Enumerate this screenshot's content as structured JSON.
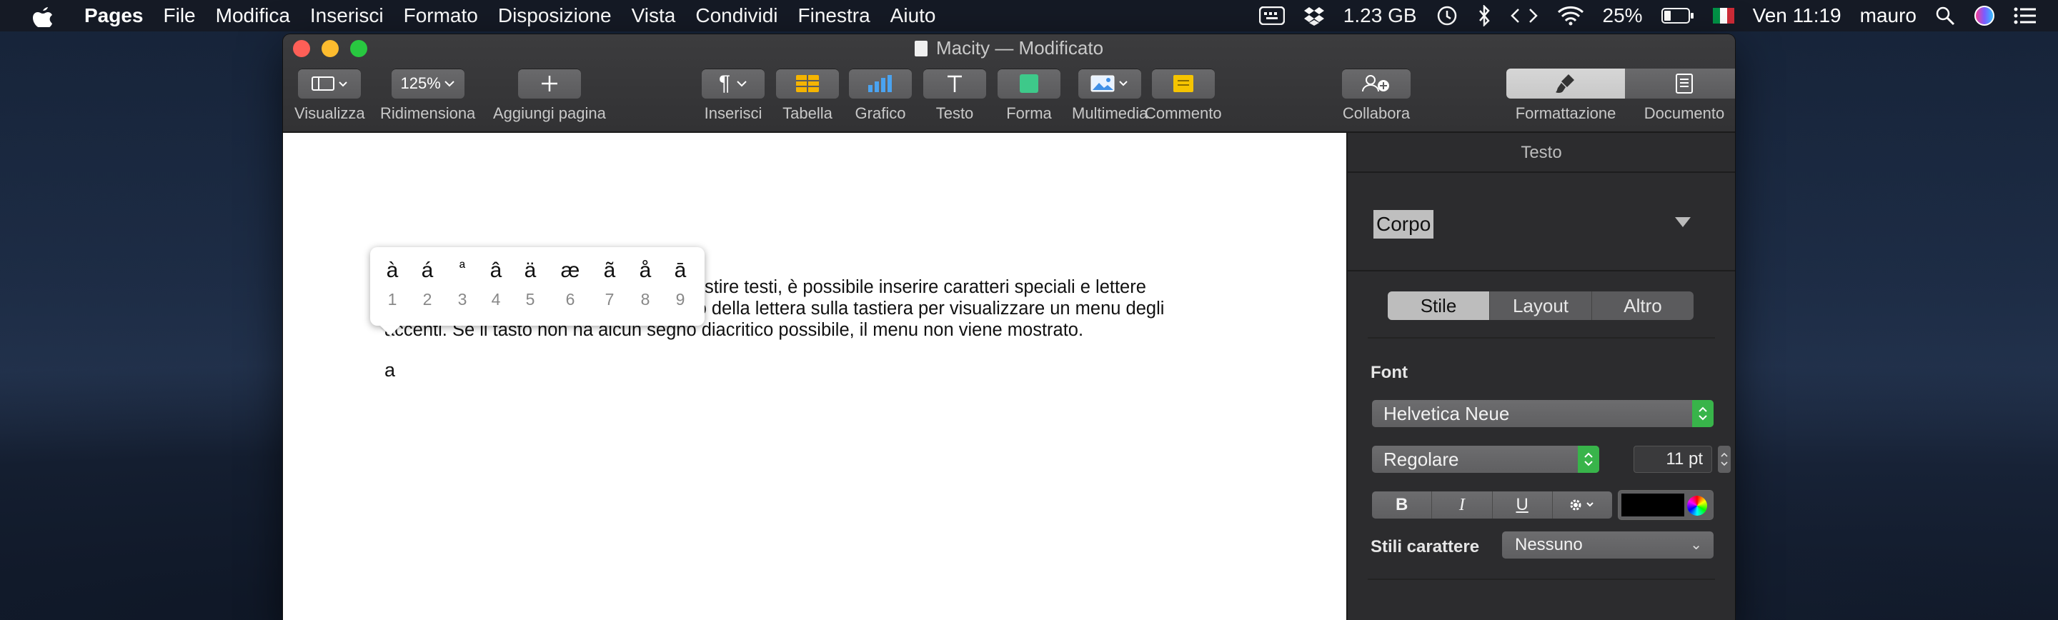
{
  "menubar": {
    "app_name": "Pages",
    "items": [
      "File",
      "Modifica",
      "Inserisci",
      "Formato",
      "Disposizione",
      "Vista",
      "Condividi",
      "Finestra",
      "Aiuto"
    ],
    "storage": "1.23 GB",
    "battery": "25%",
    "clock": "Ven 11:19",
    "user": "mauro"
  },
  "window": {
    "title": "Macity",
    "subtitle": "— Modificato"
  },
  "toolbar": {
    "visualizza": "Visualizza",
    "zoom_value": "125%",
    "ridimensiona": "Ridimensiona",
    "aggiungi_pagina": "Aggiungi pagina",
    "inserisci": "Inserisci",
    "tabella": "Tabella",
    "grafico": "Grafico",
    "testo": "Testo",
    "forma": "Forma",
    "multimedia": "Multimedia",
    "commento": "Commento",
    "collabora": "Collabora",
    "formattazione": "Formattazione",
    "documento": "Documento"
  },
  "document": {
    "lines": [
      "Nelle applicazioni che consentono di gestire testi, è possibile inserire caratteri speciali e lettere",
      "accentate.  Basta tenere premuto il tasto della lettera sulla tastiera per visualizzare un menu degli",
      "accenti. Se il tasto non ha alcun segno diacritico possibile, il menu non viene mostrato."
    ],
    "typed_char": "a",
    "accent_popup": [
      {
        "ch": "à",
        "num": "1"
      },
      {
        "ch": "á",
        "num": "2"
      },
      {
        "ch": "ª",
        "num": "3"
      },
      {
        "ch": "â",
        "num": "4"
      },
      {
        "ch": "ä",
        "num": "5"
      },
      {
        "ch": "æ",
        "num": "6"
      },
      {
        "ch": "ã",
        "num": "7"
      },
      {
        "ch": "å",
        "num": "8"
      },
      {
        "ch": "ā",
        "num": "9"
      }
    ]
  },
  "inspector": {
    "title": "Testo",
    "paragraph_style": "Corpo",
    "tabs": [
      "Stile",
      "Layout",
      "Altro"
    ],
    "font_section": "Font",
    "font_family": "Helvetica Neue",
    "font_style": "Regolare",
    "font_size": "11 pt",
    "bold": "B",
    "italic": "I",
    "underline": "U",
    "text_color": "#000000",
    "char_styles_label": "Stili carattere",
    "char_styles_value": "Nessuno"
  }
}
